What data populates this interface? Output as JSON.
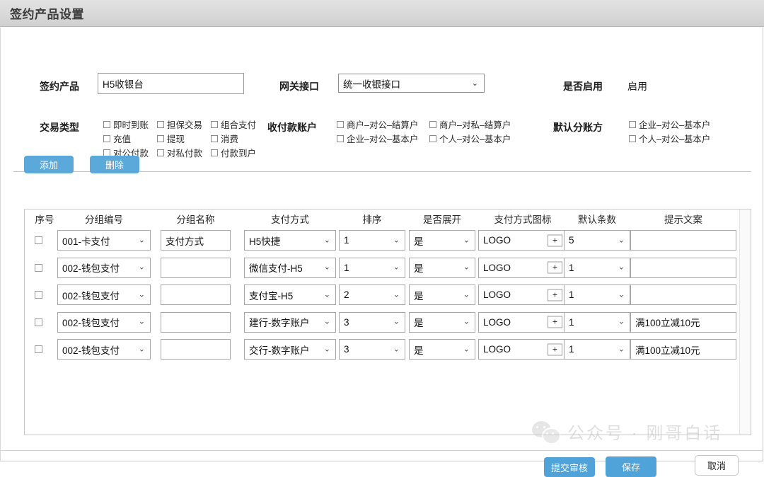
{
  "window": {
    "title": "签约产品设置"
  },
  "form": {
    "product_label": "签约产品",
    "product_value": "H5收银台",
    "gateway_label": "网关接口",
    "gateway_value": "统一收银接口",
    "enabled_label": "是否启用",
    "enabled_value": "启用",
    "txn_type_label": "交易类型",
    "txn_types": [
      [
        "即时到账",
        "担保交易",
        "组合支付"
      ],
      [
        "充值",
        "提现",
        "消费"
      ],
      [
        "对公付款",
        "对私付款",
        "付款到户"
      ]
    ],
    "account_label": "收付款账户",
    "accounts": [
      [
        "商户–对公–结算户",
        "商户–对私–结算户"
      ],
      [
        "企业–对公–基本户",
        "个人–对公–基本户"
      ]
    ],
    "split_label": "默认分账方",
    "split_options": [
      [
        "企业–对公–基本户"
      ],
      [
        "个人–对公–基本户"
      ]
    ]
  },
  "toolbar": {
    "add_label": "添加",
    "delete_label": "删除"
  },
  "table": {
    "headers": [
      "序号",
      "分组编号",
      "分组名称",
      "支付方式",
      "排序",
      "是否展开",
      "支付方式图标",
      "默认条数",
      "提示文案"
    ],
    "plus_label": "+",
    "caret": "⌄",
    "rows": [
      {
        "group_code": "001-卡支付",
        "group_name": "支付方式",
        "pay_method": "H5快捷",
        "sort": "1",
        "expand": "是",
        "icon": "LOGO",
        "default_count": "5",
        "tip": ""
      },
      {
        "group_code": "002-钱包支付",
        "group_name": "",
        "pay_method": "微信支付-H5",
        "sort": "1",
        "expand": "是",
        "icon": "LOGO",
        "default_count": "1",
        "tip": ""
      },
      {
        "group_code": "002-钱包支付",
        "group_name": "",
        "pay_method": "支付宝-H5",
        "sort": "2",
        "expand": "是",
        "icon": "LOGO",
        "default_count": "1",
        "tip": ""
      },
      {
        "group_code": "002-钱包支付",
        "group_name": "",
        "pay_method": "建行-数字账户",
        "sort": "3",
        "expand": "是",
        "icon": "LOGO",
        "default_count": "1",
        "tip": "满100立减10元"
      },
      {
        "group_code": "002-钱包支付",
        "group_name": "",
        "pay_method": "交行-数字账户",
        "sort": "3",
        "expand": "是",
        "icon": "LOGO",
        "default_count": "1",
        "tip": "满100立减10元"
      }
    ]
  },
  "footer": {
    "submit_label": "提交审核",
    "save_label": "保存",
    "cancel_label": "取消"
  },
  "watermark": {
    "text": "公众号 · 刚哥白话"
  },
  "colors": {
    "accent": "#4fa3d8",
    "titlebar": "#d9d9d9",
    "border": "#c9c9c9"
  }
}
